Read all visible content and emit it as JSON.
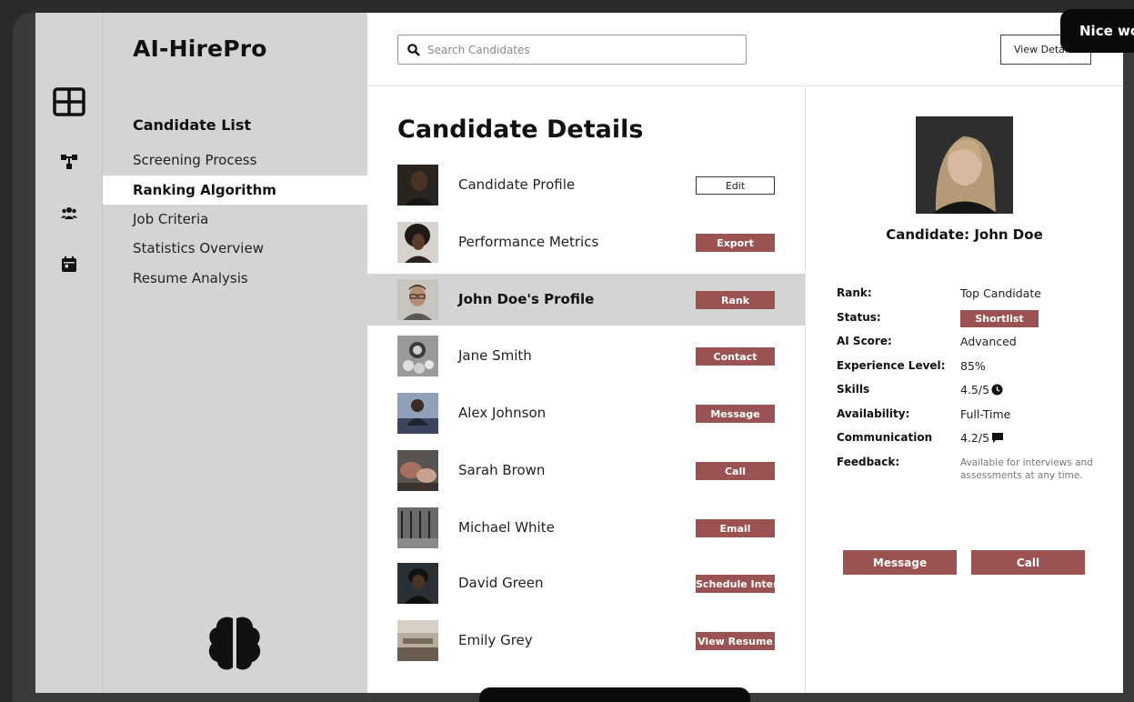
{
  "app": {
    "brand": "AI-HirePro"
  },
  "rail": {
    "icons": [
      "dashboard-grid-icon",
      "workflow-icon",
      "users-icon",
      "calendar-icon"
    ]
  },
  "sidenav": {
    "heading": "Candidate List",
    "items": [
      {
        "label": "Screening Process",
        "active": false
      },
      {
        "label": "Ranking Algorithm",
        "active": true
      },
      {
        "label": "Job Criteria",
        "active": false
      },
      {
        "label": "Statistics Overview",
        "active": false
      },
      {
        "label": "Resume Analysis",
        "active": false
      }
    ],
    "footer_icon": "brain-icon"
  },
  "topbar": {
    "search_placeholder": "Search Candidates",
    "view_details_label": "View Details"
  },
  "list": {
    "title": "Candidate Details",
    "rows": [
      {
        "label": "Candidate Profile",
        "button": "Edit",
        "style": "outline",
        "selected": false
      },
      {
        "label": "Performance Metrics",
        "button": "Export",
        "style": "filled",
        "selected": false
      },
      {
        "label": "John Doe's Profile",
        "button": "Rank",
        "style": "filled",
        "selected": true
      },
      {
        "label": "Jane Smith",
        "button": "Contact",
        "style": "filled",
        "selected": false
      },
      {
        "label": "Alex Johnson",
        "button": "Message",
        "style": "filled",
        "selected": false
      },
      {
        "label": "Sarah Brown",
        "button": "Call",
        "style": "filled",
        "selected": false
      },
      {
        "label": "Michael White",
        "button": "Email",
        "style": "filled",
        "selected": false
      },
      {
        "label": "David Green",
        "button": "Schedule Interview",
        "style": "filled",
        "selected": false
      },
      {
        "label": "Emily Grey",
        "button": "View Resume",
        "style": "filled",
        "selected": false
      }
    ]
  },
  "detail": {
    "name": "Candidate: John Doe",
    "fields": {
      "rank_label": "Rank:",
      "rank_value": "Top Candidate",
      "status_label": "Status:",
      "status_value": "Shortlist",
      "ai_score_label": "AI Score:",
      "ai_score_value": "Advanced",
      "experience_label": "Experience Level:",
      "experience_value": "85%",
      "skills_label": "Skills",
      "skills_value": "4.5/5",
      "availability_label": "Availability:",
      "availability_value": "Full-Time",
      "communication_label": "Communication",
      "communication_value": "4.2/5",
      "feedback_label": "Feedback:",
      "feedback_value": "Available for interviews and assessments at any time."
    },
    "message_button": "Message",
    "call_button": "Call"
  },
  "toast": {
    "text": "Nice work!"
  },
  "colors": {
    "accent": "#9b5252",
    "sidebar": "#d4d4d4",
    "background": "#2b2b2b"
  }
}
